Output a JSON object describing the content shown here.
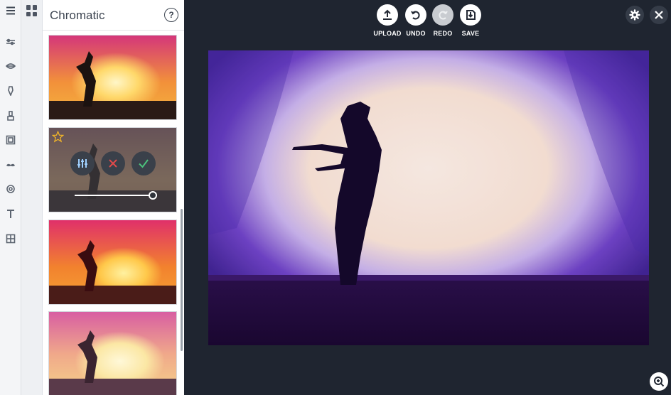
{
  "panel": {
    "title": "Chromatic",
    "help_label": "?"
  },
  "rail": {
    "items": [
      {
        "icon": "menu-icon"
      },
      {
        "icon": "sliders-icon"
      },
      {
        "icon": "eye-icon"
      },
      {
        "icon": "magic-wand-icon"
      },
      {
        "icon": "brush-icon"
      },
      {
        "icon": "frame-icon"
      },
      {
        "icon": "mustache-icon"
      },
      {
        "icon": "sticker-icon"
      },
      {
        "icon": "text-icon"
      },
      {
        "icon": "texture-icon"
      }
    ]
  },
  "toolbar": {
    "upload_label": "UPLOAD",
    "undo_label": "UNDO",
    "redo_label": "REDO",
    "save_label": "SAVE"
  },
  "active_effect": {
    "favorite_icon": "star-icon",
    "adjust_icon": "sliders-icon",
    "cancel_icon": "close-icon",
    "apply_icon": "check-icon",
    "intensity": 1.0
  },
  "colors": {
    "accent_check": "#4cc27d",
    "cancel_red": "#e04a4a",
    "star_gold": "#f0b429",
    "background": "#1f2530"
  }
}
